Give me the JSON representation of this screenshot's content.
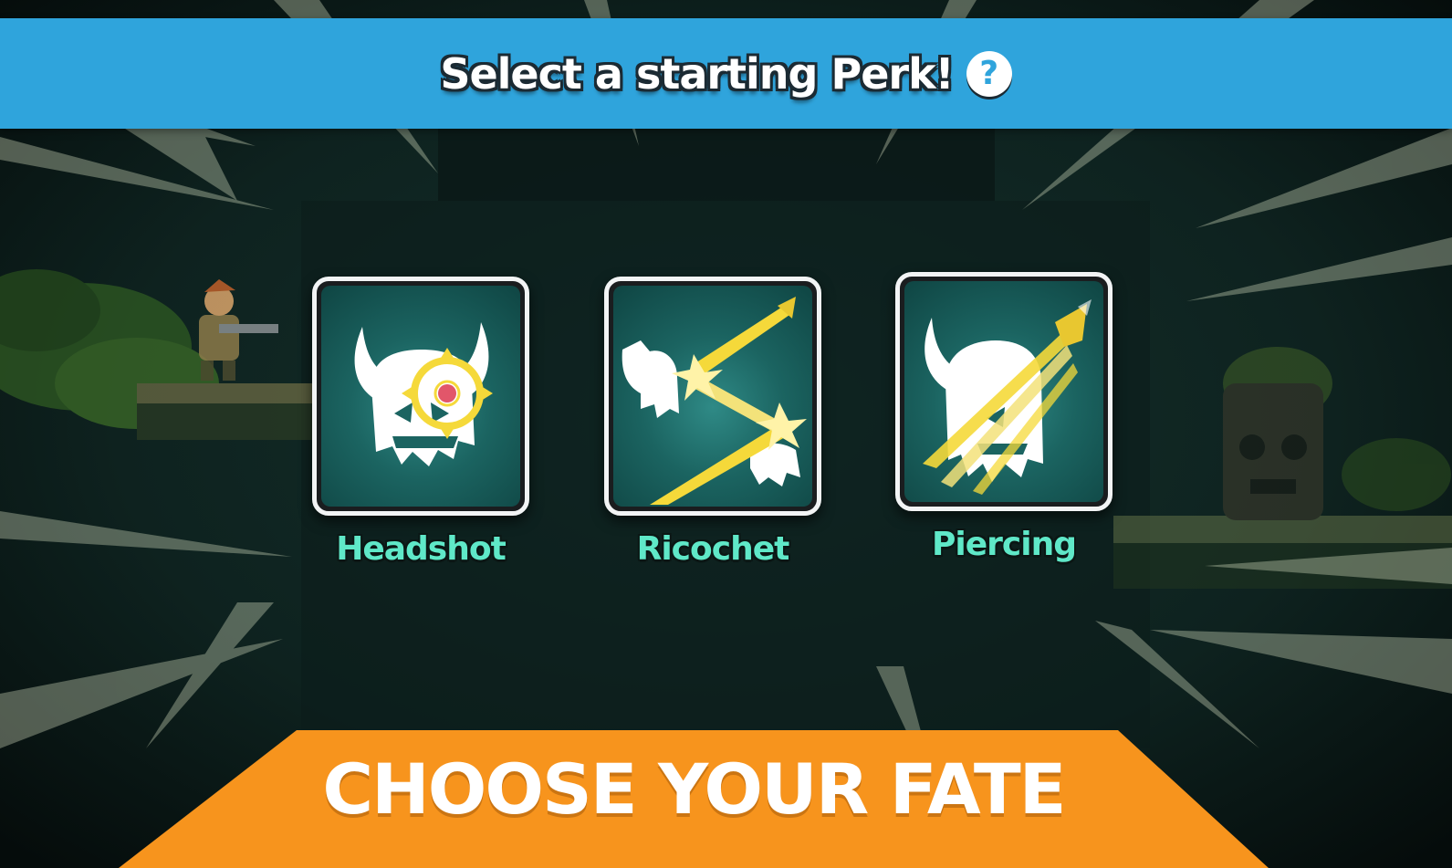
{
  "header": {
    "title": "Select a starting Perk!",
    "help_glyph": "?",
    "color": "#2fa4dc"
  },
  "perks": [
    {
      "label": "Headshot",
      "icon": "skull-crosshair-icon"
    },
    {
      "label": "Ricochet",
      "icon": "skull-ricochet-bullet-icon"
    },
    {
      "label": "Piercing",
      "icon": "skull-piercing-bullet-icon"
    }
  ],
  "footer": {
    "label": "CHOOSE YOUR FATE",
    "color": "#f7941d"
  },
  "colors": {
    "perk_label": "#5fe8c8",
    "icon_bg": "#1b6461",
    "accent_yellow": "#f5d93a"
  }
}
